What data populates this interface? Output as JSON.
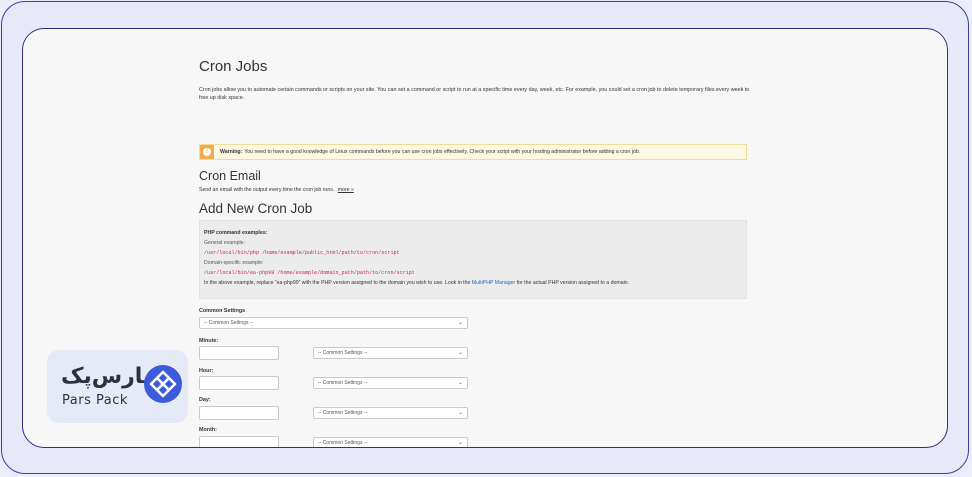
{
  "page": {
    "title": "Cron Jobs",
    "intro": "Cron jobs allow you to automate certain commands or scripts on your site. You can set a command or script to run at a specific time every day, week, etc. For example, you could set a cron job to delete temporary files every week to free up disk space."
  },
  "warning": {
    "label": "Warning:",
    "text": "You need to have a good knowledge of Linux commands before you can use cron jobs effectively. Check your script with your hosting administrator before adding a cron job."
  },
  "cron_email": {
    "heading": "Cron Email",
    "description": "Send an email with the output every time the cron job runs.",
    "more_link": "more »"
  },
  "add_new": {
    "heading": "Add New Cron Job",
    "examples": {
      "title": "PHP command examples:",
      "general_label": "General example:",
      "general_code": "/usr/local/bin/php /home/example/public_html/path/to/cron/script",
      "domain_label": "Domain-specific example:",
      "domain_code": "/usr/local/bin/ea-php99 /home/example/domain_path/path/to/cron/script",
      "note_before": "In the above example, replace “ea-php99” with the PHP version assigned to the domain you wish to use. Look in the ",
      "note_link": "MultiPHP Manager",
      "note_after": " for the actual PHP version assigned to a domain."
    }
  },
  "form": {
    "common_settings": {
      "label": "Common Settings",
      "value": "-- Common Settings --"
    },
    "minute": {
      "label": "Minute:",
      "value": "",
      "select_value": "-- Common Settings --"
    },
    "hour": {
      "label": "Hour:",
      "value": "",
      "select_value": "-- Common Settings --"
    },
    "day": {
      "label": "Day:",
      "value": "",
      "select_value": "-- Common Settings --"
    },
    "month": {
      "label": "Month:",
      "value": "",
      "select_value": "-- Common Settings --"
    }
  },
  "brand": {
    "name_fa": "پارس‌پک",
    "name_en": "Pars Pack",
    "accent": "#3b5bdb"
  },
  "colors": {
    "frame_border": "#3b3f98",
    "warning_bg": "#fcf8e3",
    "warning_icon": "#f0ad4e",
    "code": "#c7254e",
    "link": "#1b6ec2"
  }
}
